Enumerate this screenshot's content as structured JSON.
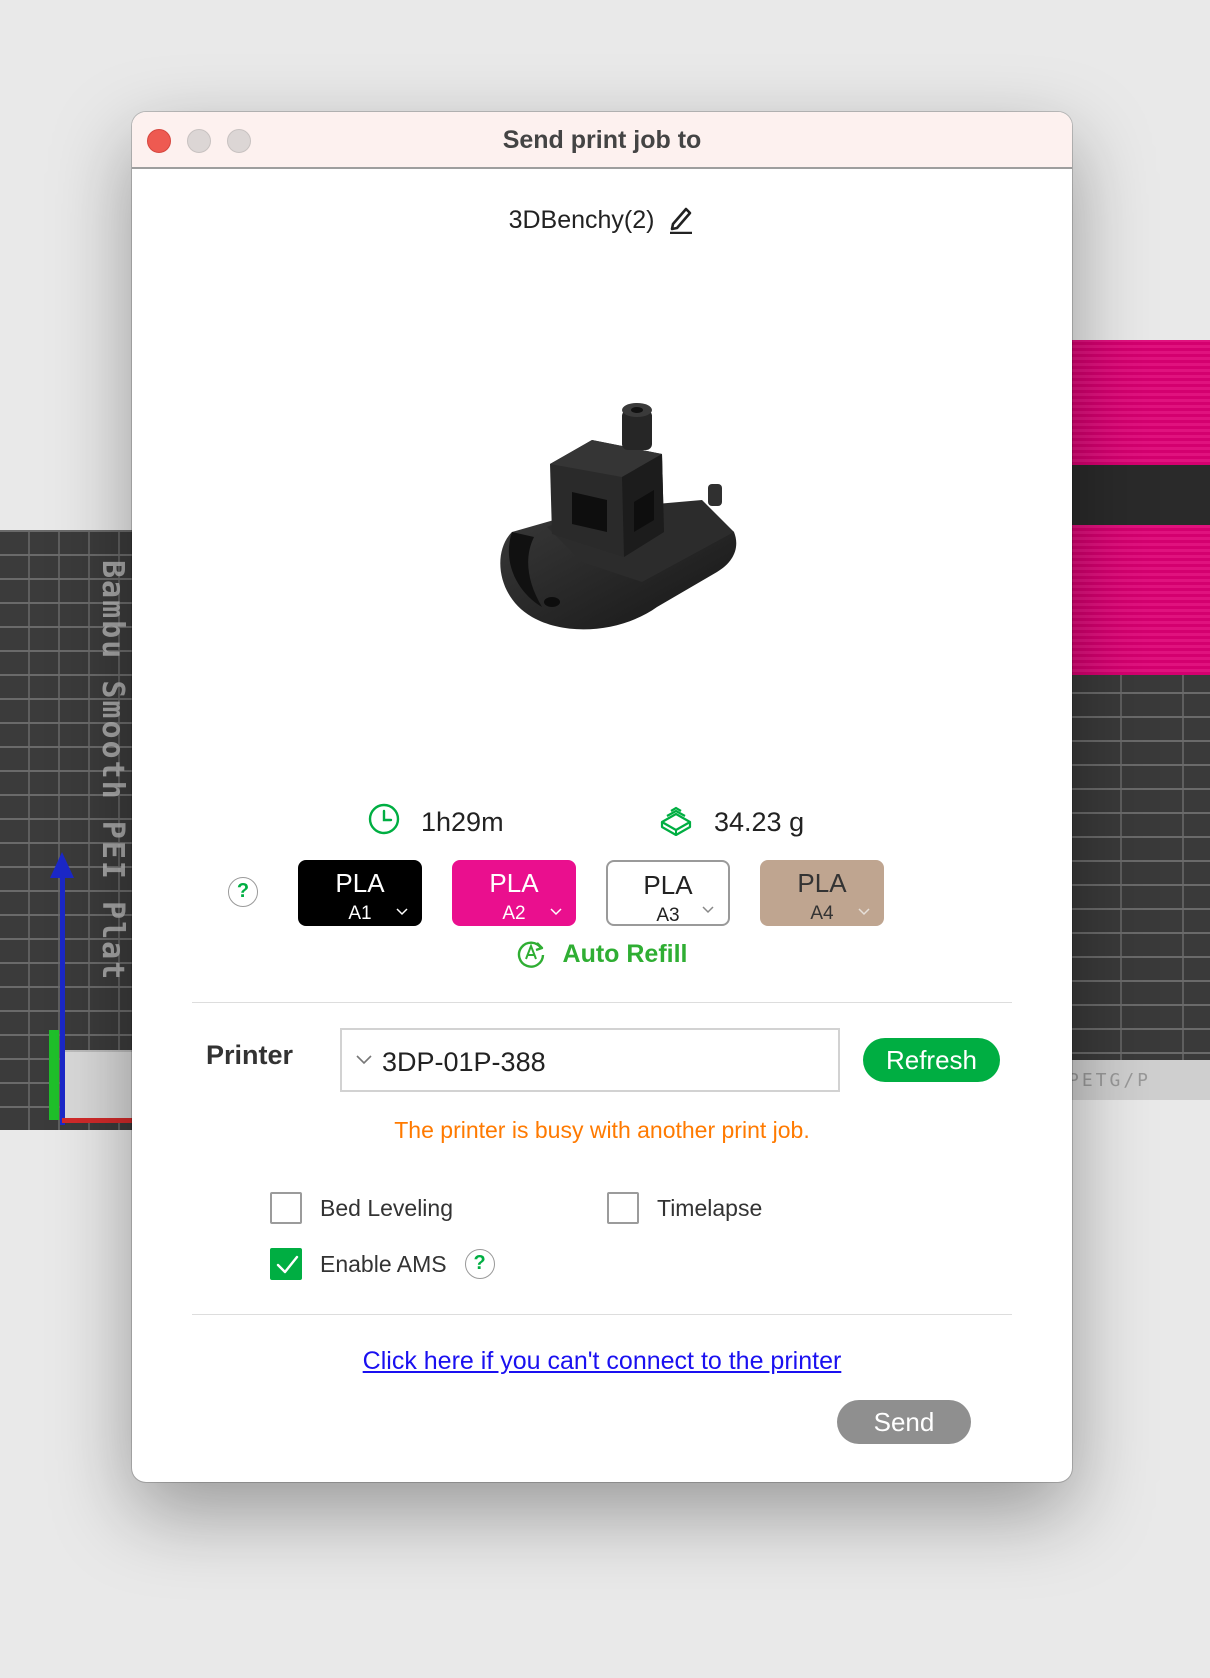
{
  "window": {
    "title": "Send print job to"
  },
  "job": {
    "name": "3DBenchy(2)"
  },
  "stats": {
    "time": "1h29m",
    "weight": "34.23 g"
  },
  "filaments": [
    {
      "type": "PLA",
      "slot": "A1",
      "color": "#000000"
    },
    {
      "type": "PLA",
      "slot": "A2",
      "color": "#ea0f8e"
    },
    {
      "type": "PLA",
      "slot": "A3",
      "color": "#ffffff"
    },
    {
      "type": "PLA",
      "slot": "A4",
      "color": "#bfa590"
    }
  ],
  "help_glyph": "?",
  "auto_refill": {
    "label": "Auto Refill"
  },
  "printer": {
    "label": "Printer",
    "selected": "3DP-01P-388",
    "refresh_label": "Refresh",
    "warning": "The printer is busy with another print job."
  },
  "options": {
    "bed_leveling": {
      "label": "Bed Leveling",
      "checked": false
    },
    "timelapse": {
      "label": "Timelapse",
      "checked": false
    },
    "enable_ams": {
      "label": "Enable AMS",
      "checked": true
    }
  },
  "footer": {
    "connect_link": "Click here if you can't connect to the printer",
    "send_label": "Send"
  },
  "background": {
    "left_plate_text": "Bambu Smooth PEI Plate High Temp",
    "right_plate_text": "PETG/P"
  },
  "colors": {
    "accent": "#00ae42",
    "warning": "#ff7a00",
    "link": "#1a10f0",
    "send_disabled": "#8f8f8f"
  }
}
